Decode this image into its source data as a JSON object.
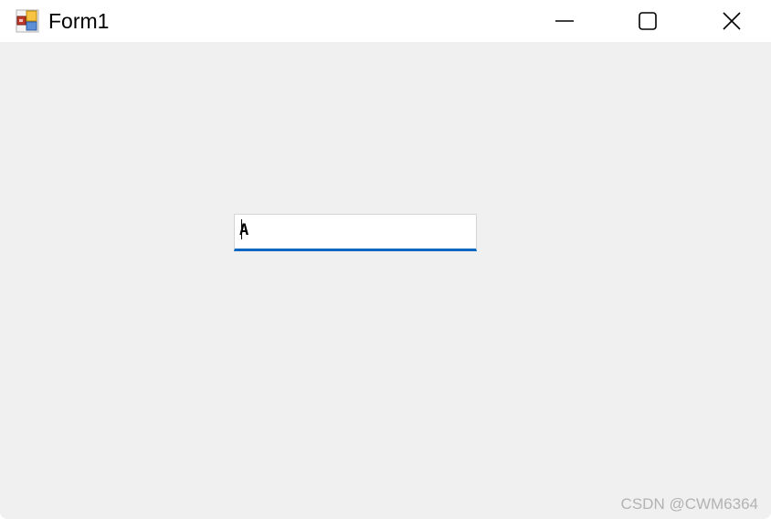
{
  "window": {
    "title": "Form1",
    "icon": "winforms-app-icon",
    "controls": {
      "minimize": "minimize-icon",
      "maximize": "maximize-icon",
      "close": "close-icon"
    }
  },
  "form": {
    "textbox": {
      "value": "A",
      "focused": true,
      "accent_color": "#0067c0"
    }
  },
  "watermark": {
    "text": "CSDN @CWM6364"
  },
  "colors": {
    "client_background": "#f0f0f0",
    "titlebar_background": "#ffffff"
  }
}
